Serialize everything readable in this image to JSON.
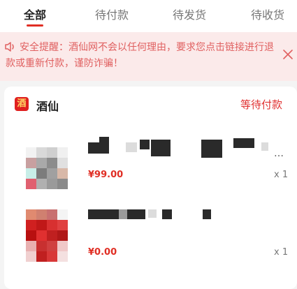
{
  "tabs": [
    {
      "label": "全部",
      "active": true
    },
    {
      "label": "待付款",
      "active": false
    },
    {
      "label": "待发货",
      "active": false
    },
    {
      "label": "待收货",
      "active": false
    }
  ],
  "notice": {
    "text": "安全提醒：酒仙网不会以任何理由，要求您点击链接进行退款或重新付款，谨防诈骗！",
    "icon": "speaker-icon",
    "close_icon": "close-icon",
    "color": "#e06060"
  },
  "order": {
    "shop_name": "酒仙",
    "shop_logo_char": "酒",
    "status": "等待付款",
    "items": [
      {
        "price": "¥99.00",
        "quantity": "x 1",
        "name_visible": "…"
      },
      {
        "price": "¥0.00",
        "quantity": "x 1"
      }
    ]
  },
  "colors": {
    "accent": "#e02e24",
    "notice_bg": "#fbeaea"
  }
}
